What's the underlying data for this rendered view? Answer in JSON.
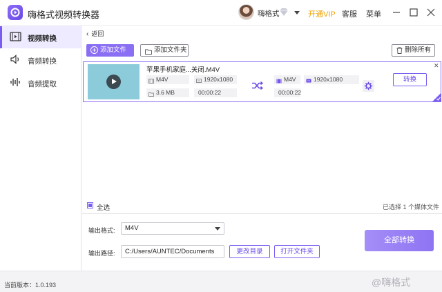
{
  "titlebar": {
    "app_title": "嗨格式视频转换器",
    "username": "嗨格式",
    "vip_label": "开通VIP",
    "service_label": "客服",
    "menu_label": "菜单"
  },
  "sidebar": {
    "items": [
      {
        "label": "视频转换",
        "icon": "video-icon",
        "active": true
      },
      {
        "label": "音频转换",
        "icon": "speaker-icon",
        "active": false
      },
      {
        "label": "音频提取",
        "icon": "waveform-icon",
        "active": false
      }
    ]
  },
  "toolbar": {
    "back_label": "返回",
    "add_file_label": "添加文件",
    "add_folder_label": "添加文件夹",
    "delete_all_label": "删除所有"
  },
  "file": {
    "name": "苹果手机家庭...关闭.M4V",
    "source": {
      "format": "M4V",
      "resolution": "1920x1080",
      "size": "3.6 MB",
      "duration": "00:00:22"
    },
    "target": {
      "format": "M4V",
      "resolution": "1920x1080",
      "duration": "00:00:22"
    },
    "convert_label": "转换",
    "selected": true
  },
  "selection": {
    "select_all_label": "全选",
    "count_text": "已选择 1 个媒体文件"
  },
  "output": {
    "format_label": "输出格式:",
    "format_value": "M4V",
    "path_label": "输出路径:",
    "path_value": "C:/Users/AUNTEC/Documents",
    "change_dir_label": "更改目录",
    "open_folder_label": "打开文件夹",
    "convert_all_label": "全部转换"
  },
  "status": {
    "version_text": "当前版本：1.0.193",
    "watermark_text": "@嗨格式"
  },
  "colors": {
    "accent": "#7b5cf0",
    "vip": "#f0a400"
  }
}
